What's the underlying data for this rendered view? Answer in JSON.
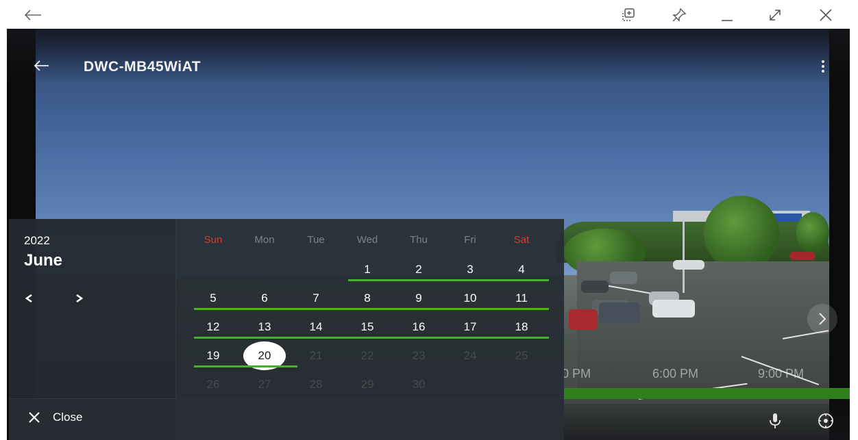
{
  "window": {
    "back_icon": "arrow-left-icon",
    "controls": [
      "screenshot-icon",
      "pin-icon",
      "minimize-icon",
      "expand-icon",
      "close-icon"
    ]
  },
  "camera": {
    "title": "DWC-MB45WiAT",
    "back_icon": "arrow-left-icon",
    "menu_icon": "kebab-menu-icon"
  },
  "timeline": {
    "labels": [
      "0 PM",
      "6:00 PM",
      "9:00 PM"
    ],
    "next_icon": "chevron-right-icon",
    "mic_icon": "microphone-icon",
    "ptz_icon": "ptz-control-icon"
  },
  "calendar": {
    "year": "2022",
    "month": "June",
    "prev_label": "<",
    "next_label": ">",
    "weekdays": [
      "Sun",
      "Mon",
      "Tue",
      "Wed",
      "Thu",
      "Fri",
      "Sat"
    ],
    "weeks": [
      [
        "",
        "",
        "",
        "1",
        "2",
        "3",
        "4"
      ],
      [
        "5",
        "6",
        "7",
        "8",
        "9",
        "10",
        "11"
      ],
      [
        "12",
        "13",
        "14",
        "15",
        "16",
        "17",
        "18"
      ],
      [
        "19",
        "20",
        "21",
        "22",
        "23",
        "24",
        "25"
      ],
      [
        "26",
        "27",
        "28",
        "29",
        "30",
        "",
        ""
      ]
    ],
    "selected_day": "20",
    "close_label": "Close",
    "close_icon": "close-icon",
    "colors": {
      "weekend_header": "#e0372e",
      "recording_underline": "#48b02a"
    }
  }
}
